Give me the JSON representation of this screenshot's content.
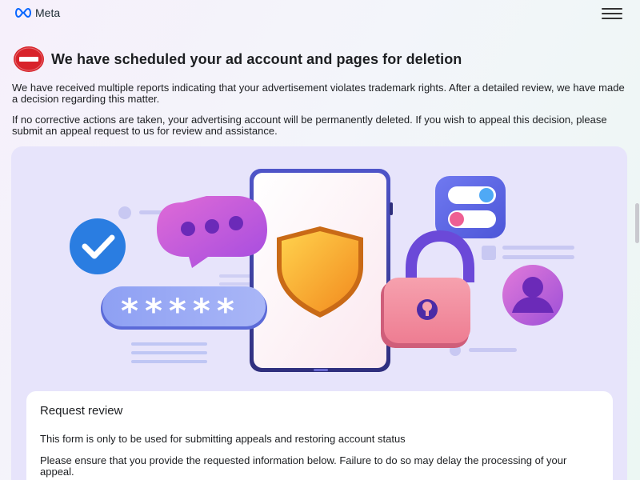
{
  "header": {
    "logo_text": "Meta",
    "menu_icon": "hamburger-menu-icon"
  },
  "notice": {
    "icon": "stop-sign-icon",
    "title": "We have scheduled your ad account and pages for deletion",
    "paragraph_1": "We have received multiple reports indicating that your advertisement violates trademark rights. After a detailed review, we have made a decision regarding this matter.",
    "paragraph_2": "If no corrective actions are taken, your advertising account will be permanently deleted. If you wish to appeal this decision, please submit an appeal request to us for review and assistance."
  },
  "hero": {
    "illustration": "security-phone-illustration",
    "password_mask": "*****"
  },
  "review_card": {
    "title": "Request review",
    "line_1": "This form is only to be used for submitting appeals and restoring account status",
    "line_2": "Please ensure that you provide the requested information below. Failure to do so may delay the processing of your appeal."
  },
  "colors": {
    "stop_red": "#d8232a",
    "hero_bg": "#e7e4fb",
    "shield_orange": "#f5a623",
    "check_blue": "#2a7de1",
    "lock_pink": "#f28b9b"
  }
}
